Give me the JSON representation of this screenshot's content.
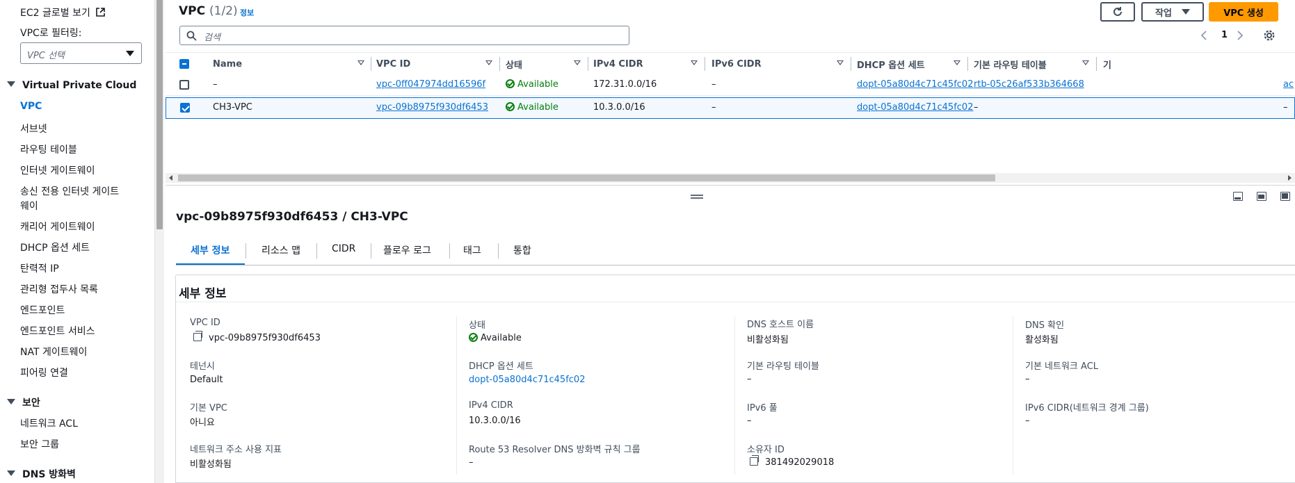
{
  "sidebar": {
    "ec2_global_view": "EC2 글로벌 보기",
    "filter_label": "VPC로 필터링:",
    "filter_placeholder": "VPC 선택",
    "section_vpc": "Virtual Private Cloud",
    "vpc_items": [
      "VPC",
      "서브넷",
      "라우팅 테이블",
      "인터넷 게이트웨이",
      "송신 전용 인터넷 게이트",
      "웨이",
      "캐리어 게이트웨이",
      "DHCP 옵션 세트",
      "탄력적 IP",
      "관리형 접두사 목록",
      "엔드포인트",
      "엔드포인트 서비스",
      "NAT 게이트웨이",
      "피어링 연결"
    ],
    "section_security": "보안",
    "security_items": [
      "네트워크 ACL",
      "보안 그룹"
    ],
    "section_dns": "DNS 방화벽"
  },
  "list": {
    "title": "VPC",
    "count": "(1/2)",
    "info": "정보",
    "actions_label": "작업",
    "create_label": "VPC 생성",
    "search_placeholder": "검색",
    "page_number": "1",
    "columns": [
      "Name",
      "VPC ID",
      "상태",
      "IPv4 CIDR",
      "IPv6 CIDR",
      "DHCP 옵션 세트",
      "기본 라우팅 테이블",
      "기"
    ],
    "rows": [
      {
        "name": "–",
        "vpc_id": "vpc-0ff047974dd16596f",
        "status": "Available",
        "ipv4": "172.31.0.0/16",
        "ipv6": "–",
        "dhcp": "dopt-05a80d4c71c45fc02",
        "route_table": "rtb-05c26af533b364668",
        "extra": "ac"
      },
      {
        "name": "CH3-VPC",
        "vpc_id": "vpc-09b8975f930df6453",
        "status": "Available",
        "ipv4": "10.3.0.0/16",
        "ipv6": "–",
        "dhcp": "dopt-05a80d4c71c45fc02",
        "route_table": "–",
        "extra": "–"
      }
    ]
  },
  "detail": {
    "title": "vpc-09b8975f930df6453 / CH3-VPC",
    "tabs": [
      "세부 정보",
      "리소스 맵",
      "CIDR",
      "플로우 로그",
      "태그",
      "통합"
    ],
    "section_title": "세부 정보",
    "fields": {
      "vpc_id_label": "VPC ID",
      "vpc_id": "vpc-09b8975f930df6453",
      "tenancy_label": "테넌시",
      "tenancy": "Default",
      "default_vpc_label": "기본 VPC",
      "default_vpc": "아니요",
      "net_usage_label": "네트워크 주소 사용 지표",
      "net_usage": "비활성화됨",
      "state_label": "상태",
      "state": "Available",
      "dhcp_label": "DHCP 옵션 세트",
      "dhcp": "dopt-05a80d4c71c45fc02",
      "ipv4_label": "IPv4 CIDR",
      "ipv4": "10.3.0.0/16",
      "route53_label": "Route 53 Resolver DNS 방화벽 규칙 그룹",
      "route53": "–",
      "dns_host_label": "DNS 호스트 이름",
      "dns_host": "비활성화됨",
      "main_rt_label": "기본 라우팅 테이블",
      "main_rt": "–",
      "ipv6_pool_label": "IPv6 풀",
      "ipv6_pool": "–",
      "owner_label": "소유자 ID",
      "owner": "381492029018",
      "dns_res_label": "DNS 확인",
      "dns_res": "활성화됨",
      "main_acl_label": "기본 네트워크 ACL",
      "main_acl": "–",
      "ipv6_cidr_label": "IPv6 CIDR(네트워크 경계 그룹)",
      "ipv6_cidr": "–"
    }
  },
  "colors": {
    "link": "#0972d3",
    "primary": "#ff9900",
    "success": "#037f0c"
  }
}
